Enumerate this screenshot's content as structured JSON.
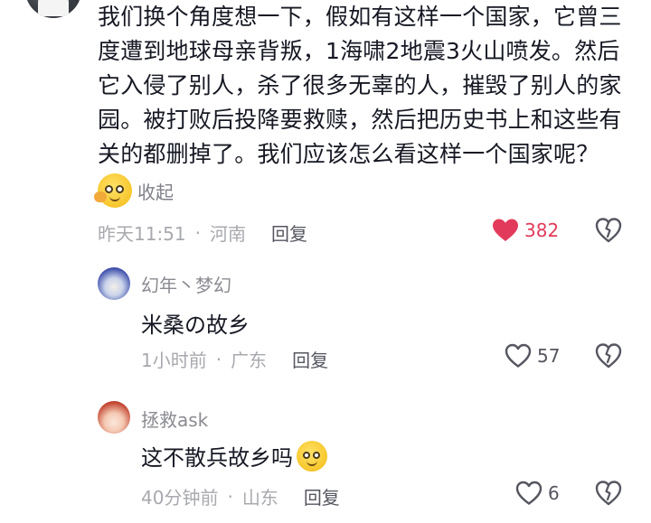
{
  "main_comment": {
    "text": "我们换个角度想一下，假如有这样一个国家，它曾三度遭到地球母亲背叛，1海啸2地震3火山喷发。然后它入侵了别人，杀了很多无辜的人，摧毁了别人的家园。被打败后投降要救赎，然后把历史书上和这些有关的都删掉了。我们应该怎么看这样一个国家呢？",
    "collapse_label": "收起",
    "time": "昨天11:51",
    "location": "河南",
    "reply_label": "回复",
    "likes": "382",
    "liked": true
  },
  "replies": [
    {
      "username": "幻年丶梦幻",
      "text": "米桑の故乡",
      "time": "1小时前",
      "location": "广东",
      "reply_label": "回复",
      "likes": "57"
    },
    {
      "username": "拯救ask",
      "text": "这不散兵故乡吗",
      "time": "40分钟前",
      "location": "山东",
      "reply_label": "回复",
      "likes": "6"
    }
  ],
  "separator": "·",
  "colors": {
    "like_red": "#e23a5b",
    "meta_gray": "#a8a9ae",
    "text": "#161823"
  },
  "icons": [
    "heart-icon",
    "dislike-heart-icon",
    "thinking-emoji-icon",
    "sweat-smile-emoji-icon"
  ]
}
